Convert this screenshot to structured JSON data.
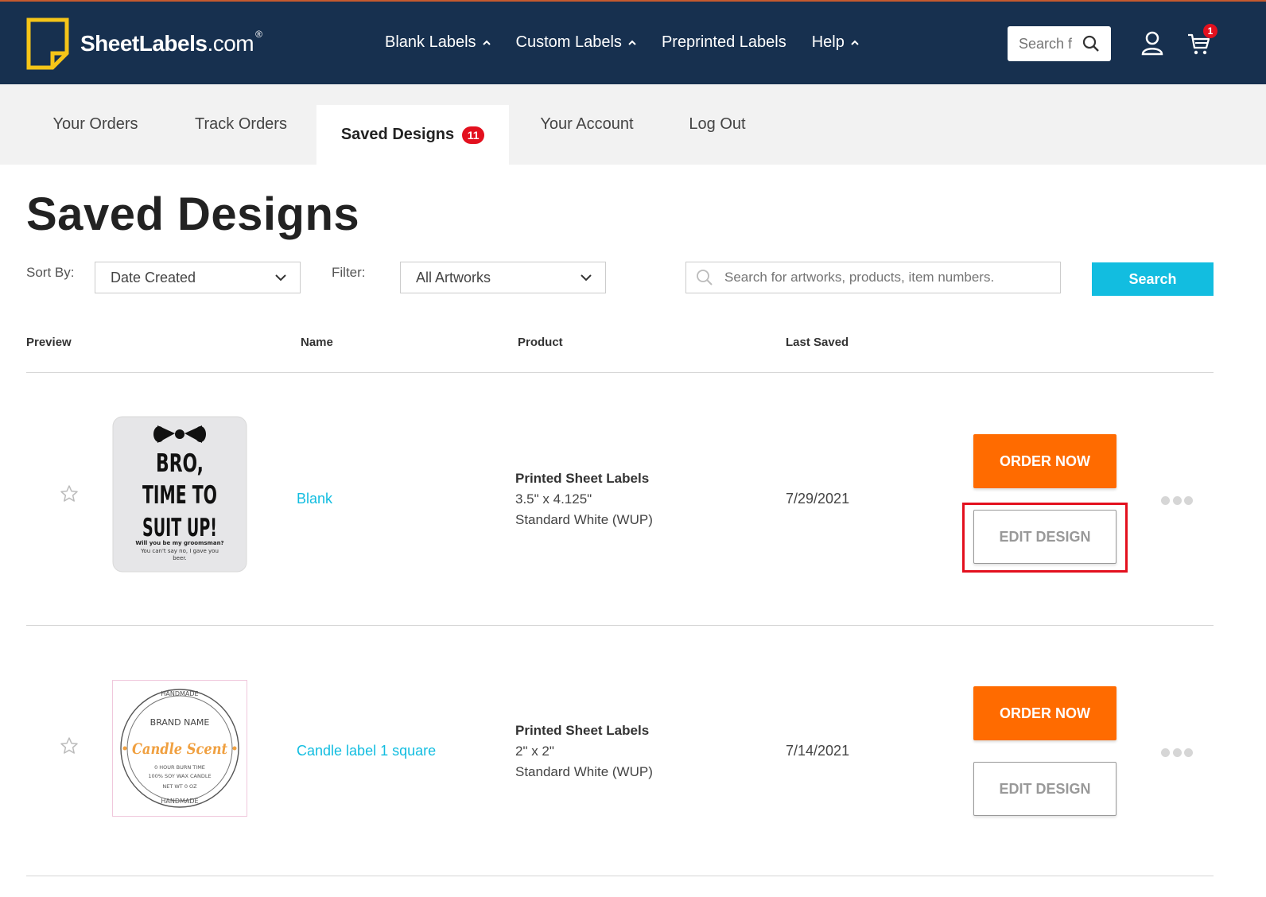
{
  "header": {
    "logo_brand": "SheetLabels",
    "logo_suffix": ".com",
    "logo_reg": "®",
    "nav": [
      {
        "label": "Blank Labels",
        "has_dropdown": true
      },
      {
        "label": "Custom Labels",
        "has_dropdown": true
      },
      {
        "label": "Preprinted Labels",
        "has_dropdown": false
      },
      {
        "label": "Help",
        "has_dropdown": true
      }
    ],
    "search_placeholder": "Search f",
    "cart_count": "1"
  },
  "tabs": [
    {
      "label": "Your Orders",
      "active": false
    },
    {
      "label": "Track Orders",
      "active": false
    },
    {
      "label": "Saved Designs",
      "active": true,
      "badge": "11"
    },
    {
      "label": "Your Account",
      "active": false
    },
    {
      "label": "Log Out",
      "active": false
    }
  ],
  "page_title": "Saved Designs",
  "controls": {
    "sort_label": "Sort By:",
    "sort_value": "Date Created",
    "filter_label": "Filter:",
    "filter_value": "All Artworks",
    "search_placeholder": "Search for artworks, products, item numbers.",
    "search_button": "Search"
  },
  "table": {
    "headers": [
      "Preview",
      "Name",
      "Product",
      "Last Saved"
    ],
    "rows": [
      {
        "name": "Blank",
        "product_title": "Printed Sheet Labels",
        "size": "3.5\" x 4.125\"",
        "material": "Standard White (WUP)",
        "last_saved": "7/29/2021",
        "order_label": "ORDER NOW",
        "edit_label": "EDIT DESIGN",
        "edit_highlighted": true,
        "preview": {
          "line1": "BRO,",
          "line2": "TIME TO",
          "line3": "SUIT UP!",
          "small1": "Will you be my groomsman?",
          "small2": "You can't say no, I gave you",
          "small3": "beer."
        }
      },
      {
        "name": "Candle label 1 square",
        "product_title": "Printed Sheet Labels",
        "size": "2\" x 2\"",
        "material": "Standard White (WUP)",
        "last_saved": "7/14/2021",
        "order_label": "ORDER NOW",
        "edit_label": "EDIT DESIGN",
        "edit_highlighted": false,
        "preview": {
          "arc_top": "HANDMADE",
          "brand": "BRAND NAME",
          "scent": "Candle Scent",
          "burn": "0 HOUR BURN TIME",
          "wax": "100% SOY WAX CANDLE",
          "weight": "NET WT 0 OZ",
          "arc_bottom": "HANDMADE"
        }
      }
    ]
  },
  "colors": {
    "header_bg": "#17304f",
    "accent_cyan": "#12bde0",
    "order_orange": "#ff6b00",
    "badge_red": "#e3101e",
    "logo_yellow": "#f5c518"
  }
}
